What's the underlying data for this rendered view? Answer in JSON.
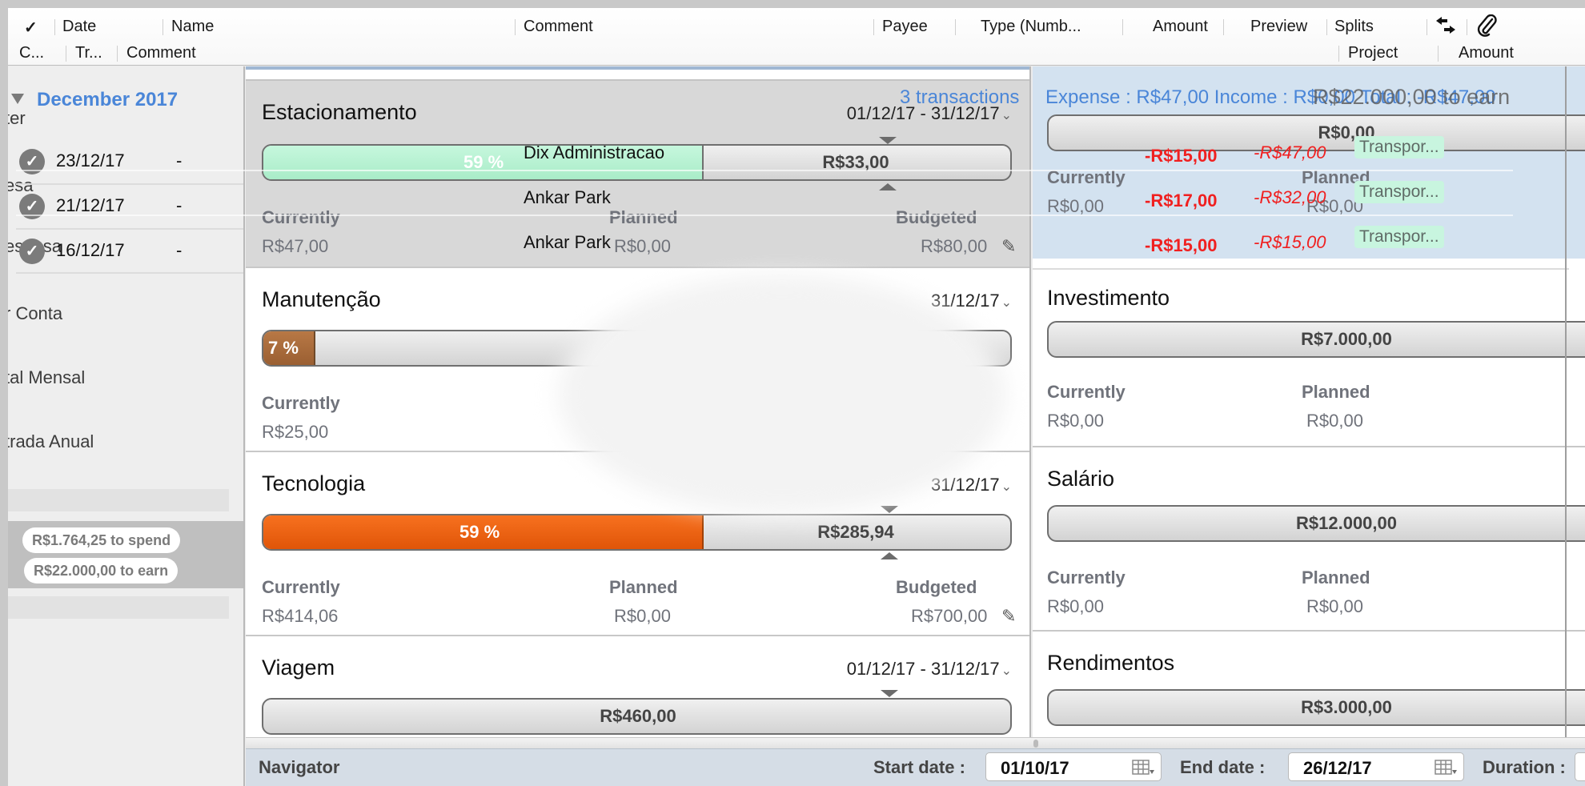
{
  "header": {
    "row1": [
      "✓",
      "Date",
      "Name",
      "Comment",
      "Payee",
      "Type (Numb...",
      "Amount",
      "Preview",
      "Splits"
    ],
    "row2": [
      "C...",
      "Tr...",
      "Comment",
      "Project",
      "Amount"
    ],
    "icons": [
      "transfer-arrows-icon",
      "paperclip-icon"
    ]
  },
  "sidebar": {
    "ghost_items": [
      "ter",
      "esa",
      "espesa",
      "r Conta",
      "tal Mensal",
      "trada Anual"
    ],
    "month_group": "December 2017",
    "transactions": [
      {
        "date": "23/12/17",
        "value": "-",
        "checked": true
      },
      {
        "date": "21/12/17",
        "value": "-",
        "checked": true
      },
      {
        "date": "16/12/17",
        "value": "-",
        "checked": true
      }
    ],
    "to_spend": "R$1.764,25 to spend",
    "to_earn": "R$22.000,00 to earn"
  },
  "expense_cards": [
    {
      "title": "Estacionamento",
      "period": "01/12/17 - 31/12/17",
      "percent_label": "59 %",
      "percent": 59,
      "remaining": "R$33,00",
      "fill_color": "#b9f2d3",
      "currently_label": "Currently",
      "currently": "R$47,00",
      "planned_label": "Planned",
      "planned": "R$0,00",
      "budgeted_label": "Budgeted",
      "budgeted": "R$80,00",
      "selected": true
    },
    {
      "title": "Manutenção",
      "period": "31/12/17",
      "percent_label": "7 %",
      "percent": 7,
      "remaining": "",
      "fill_color": "#a9683b",
      "currently_label": "Currently",
      "currently": "R$25,00"
    },
    {
      "title": "Tecnologia",
      "period": "31/12/17",
      "percent_label": "59 %",
      "percent": 59,
      "remaining": "R$285,94",
      "fill_color": "#ee5f14",
      "currently_label": "Currently",
      "currently": "R$414,06",
      "planned_label": "Planned",
      "planned": "R$0,00",
      "budgeted_label": "Budgeted",
      "budgeted": "R$700,00"
    },
    {
      "title": "Viagem",
      "period": "01/12/17 - 31/12/17",
      "remaining": "R$460,00"
    }
  ],
  "income_cards": [
    {
      "title": "",
      "remaining": "R$0,00",
      "currently_label": "Currently",
      "currently": "R$0,00",
      "planned_label": "Planned",
      "planned": "R$0,00"
    },
    {
      "title": "Investimento",
      "remaining": "R$7.000,00",
      "currently_label": "Currently",
      "currently": "R$0,00",
      "planned_label": "Planned",
      "planned": "R$0,00"
    },
    {
      "title": "Salário",
      "remaining": "R$12.000,00",
      "currently_label": "Currently",
      "currently": "R$0,00",
      "planned_label": "Planned",
      "planned": "R$0,00"
    },
    {
      "title": "Rendimentos",
      "remaining": "R$3.000,00"
    }
  ],
  "overlay": {
    "transactions_count": "3 transactions",
    "summary": "Expense : R$47,00   Income : R$0,00   Total : -R$47,00",
    "earn_ghost": "R$22.000,00 to earn",
    "rows": [
      {
        "payee": "Dix Administracao",
        "amount": "-R$15,00",
        "running": "-R$47,00",
        "category": "Transpor..."
      },
      {
        "payee": "Ankar Park",
        "amount": "-R$17,00",
        "running": "-R$32,00",
        "category": "Transpor..."
      },
      {
        "payee": "Ankar Park",
        "amount": "-R$15,00",
        "running": "-R$15,00",
        "category": "Transpor..."
      }
    ]
  },
  "navigator": {
    "title": "Navigator",
    "start_label": "Start date :",
    "start_value": "01/10/17",
    "end_label": "End date :",
    "end_value": "26/12/17",
    "duration_label": "Duration :"
  }
}
